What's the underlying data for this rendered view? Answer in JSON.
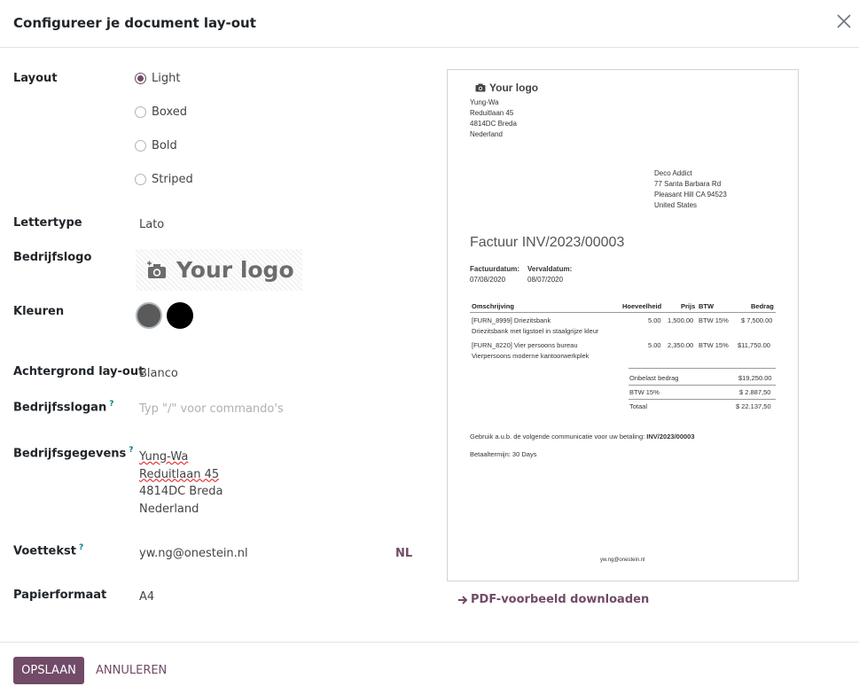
{
  "dialog": {
    "title": "Configureer je document lay-out"
  },
  "form": {
    "layout": {
      "label": "Layout",
      "options": [
        "Light",
        "Boxed",
        "Bold",
        "Striped"
      ],
      "selected": "Light"
    },
    "font": {
      "label": "Lettertype",
      "value": "Lato"
    },
    "logo": {
      "label": "Bedrijfslogo",
      "placeholder_text": "Your logo"
    },
    "colors": {
      "label": "Kleuren",
      "primary": "#5a5a5a",
      "secondary": "#000000"
    },
    "background": {
      "label": "Achtergrond lay-out",
      "value": "Blanco"
    },
    "slogan": {
      "label": "Bedrijfsslogan",
      "help": "?",
      "placeholder": "Typ \"/\" voor commando's"
    },
    "company": {
      "label": "Bedrijfsgegevens",
      "help": "?",
      "lines": [
        "Yung-Wa",
        "Reduitlaan 45",
        "4814DC Breda",
        "Nederland"
      ]
    },
    "footer": {
      "label": "Voettekst",
      "help": "?",
      "value": "yw.ng@onestein.nl",
      "lang": "NL"
    },
    "paper": {
      "label": "Papierformaat",
      "value": "A4"
    }
  },
  "preview": {
    "logo_text": "Your logo",
    "company_lines": [
      "Yung-Wa",
      "Reduitlaan 45",
      "4814DC Breda",
      "Nederland"
    ],
    "customer_lines": [
      "Deco Addict",
      "77 Santa Barbara Rd",
      "Pleasant Hill CA 94523",
      "United States"
    ],
    "invoice_title": "Factuur INV/2023/00003",
    "invoice_date_label": "Factuurdatum:",
    "invoice_date": "07/08/2020",
    "due_date_label": "Vervaldatum:",
    "due_date": "08/07/2020",
    "table_headers": [
      "Omschrijving",
      "Hoeveelheid",
      "Prijs",
      "BTW",
      "Bedrag"
    ],
    "rows": [
      {
        "desc1": "[FURN_8999] Driezitsbank",
        "desc2": "Driezitsbank met ligstoel in staalgrijze kleur",
        "qty": "5.00",
        "price": "1,500.00",
        "tax": "BTW 15%",
        "amount": "$ 7,500.00"
      },
      {
        "desc1": "[FURN_8220] Vier persoons bureau",
        "desc2": "Vierpersoons moderne kantoorwerkplek",
        "qty": "5.00",
        "price": "2,350.00",
        "tax": "BTW 15%",
        "amount": "$11,750.00"
      }
    ],
    "totals": [
      {
        "label": "Onbelast bedrag",
        "value": "$19,250.00"
      },
      {
        "label": "BTW 15%",
        "value": "$ 2.887,50"
      },
      {
        "label": "Totaal",
        "value": "$ 22.137,50"
      }
    ],
    "payment_text": "Gebruik a.u.b. de volgende communicatie voor uw betaling:",
    "payment_ref": "INV/2023/00003",
    "payment_terms": "Betaaltermijn: 30 Days",
    "footer_email": "yw.ng@onestein.nl"
  },
  "download_label": "PDF-voorbeeld downloaden",
  "buttons": {
    "save": "OPSLAAN",
    "cancel": "ANNULEREN"
  }
}
